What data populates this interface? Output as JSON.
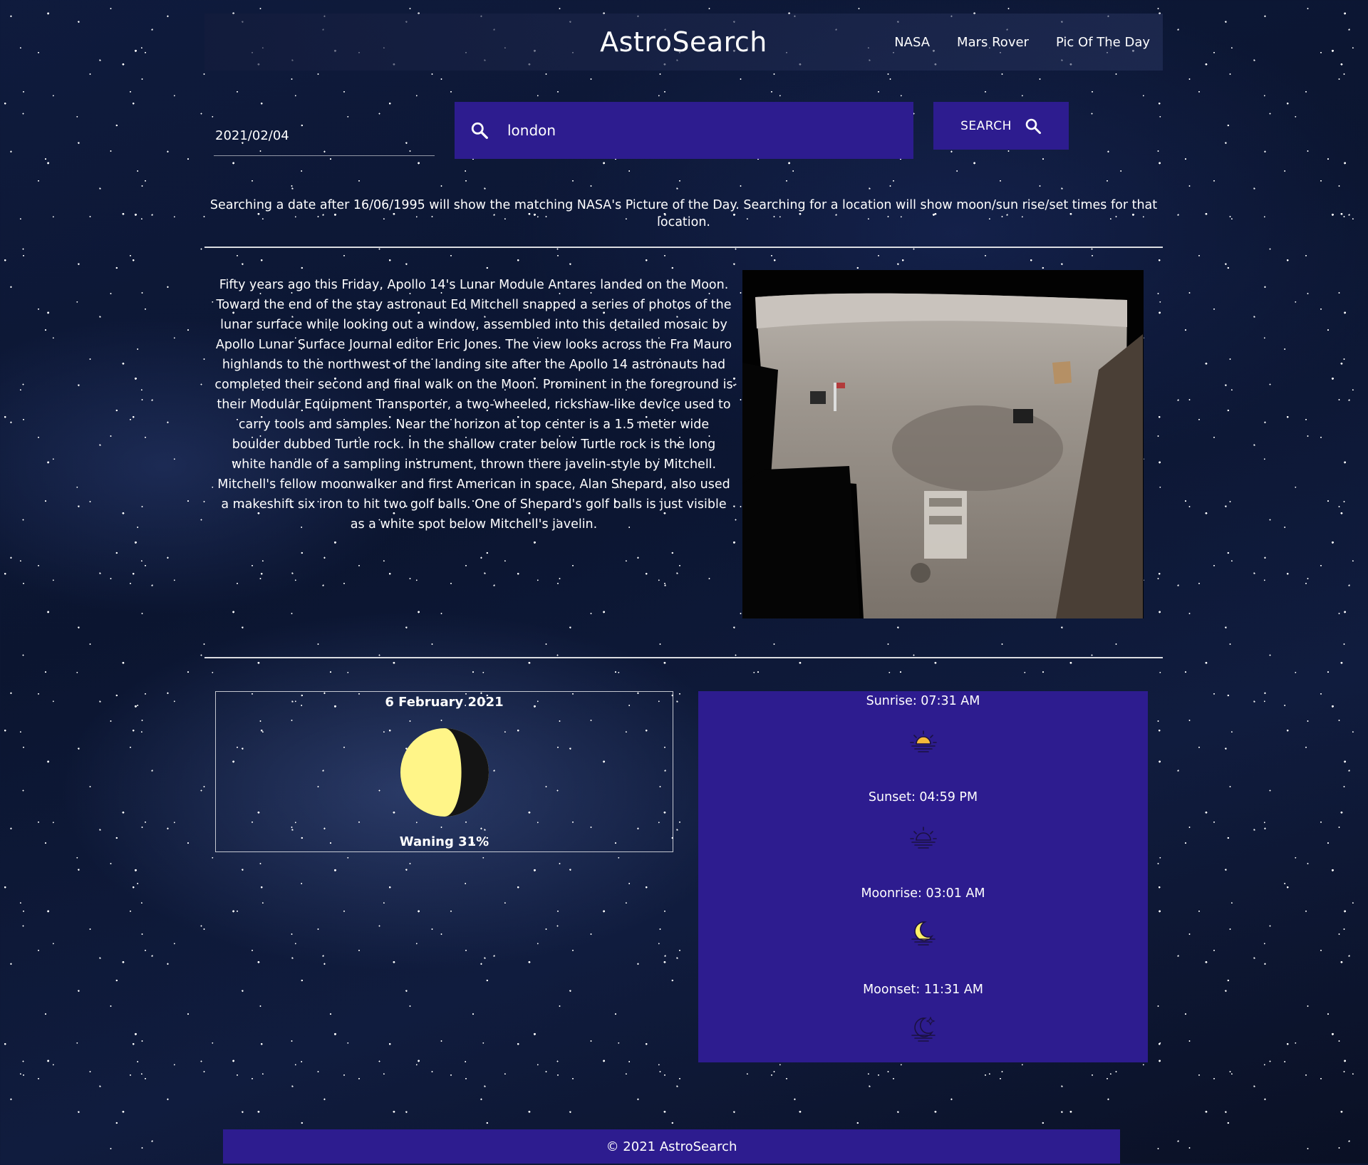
{
  "header": {
    "brand": "AstroSearch",
    "nav": [
      "NASA",
      "Mars Rover",
      "Pic Of The Day"
    ]
  },
  "search": {
    "date_value": "2021/02/04",
    "location_value": "london",
    "button_label": "SEARCH"
  },
  "hint": "Searching a date after 16/06/1995 will show the matching NASA's Picture of the Day. Searching for a location will show moon/sun rise/set times for that location.",
  "apod": {
    "explanation": "Fifty years ago this Friday, Apollo 14's Lunar Module Antares landed on the Moon. Toward the end of the stay astronaut Ed Mitchell snapped a series of photos of the lunar surface while looking out a window, assembled into this detailed mosaic by Apollo Lunar Surface Journal editor Eric Jones. The view looks across the Fra Mauro highlands to the northwest of the landing site after the Apollo 14 astronauts had completed their second and final walk on the Moon. Prominent in the foreground is their Modular Equipment Transporter, a two-wheeled, rickshaw-like device used to carry tools and samples. Near the horizon at top center is a 1.5 meter wide boulder dubbed Turtle rock. In the shallow crater below Turtle rock is the long white handle of a sampling instrument, thrown there javelin-style by Mitchell. Mitchell's fellow moonwalker and first American in space, Alan Shepard, also used a makeshift six iron to hit two golf balls. One of Shepard's golf balls is just visible as a white spot below Mitchell's javelin."
  },
  "moon": {
    "date": "6 February 2021",
    "phase": "Waning 31%",
    "illumination": 0.31
  },
  "times": {
    "sunrise": "Sunrise: 07:31 AM",
    "sunset": "Sunset: 04:59 PM",
    "moonrise": "Moonrise: 03:01 AM",
    "moonset": "Moonset: 11:31 AM"
  },
  "footer": "© 2021 AstroSearch",
  "colors": {
    "accent": "#2d1c8f",
    "moon_lit": "#fff588",
    "moon_dark": "#141414",
    "sun_icon": "#f5b93a",
    "moon_icon": "#fff066"
  },
  "icons": {
    "search": "search-icon",
    "sunrise": "sunrise-icon",
    "sunset": "sunset-icon",
    "moonrise": "moonrise-icon",
    "moonset": "moonset-icon"
  }
}
